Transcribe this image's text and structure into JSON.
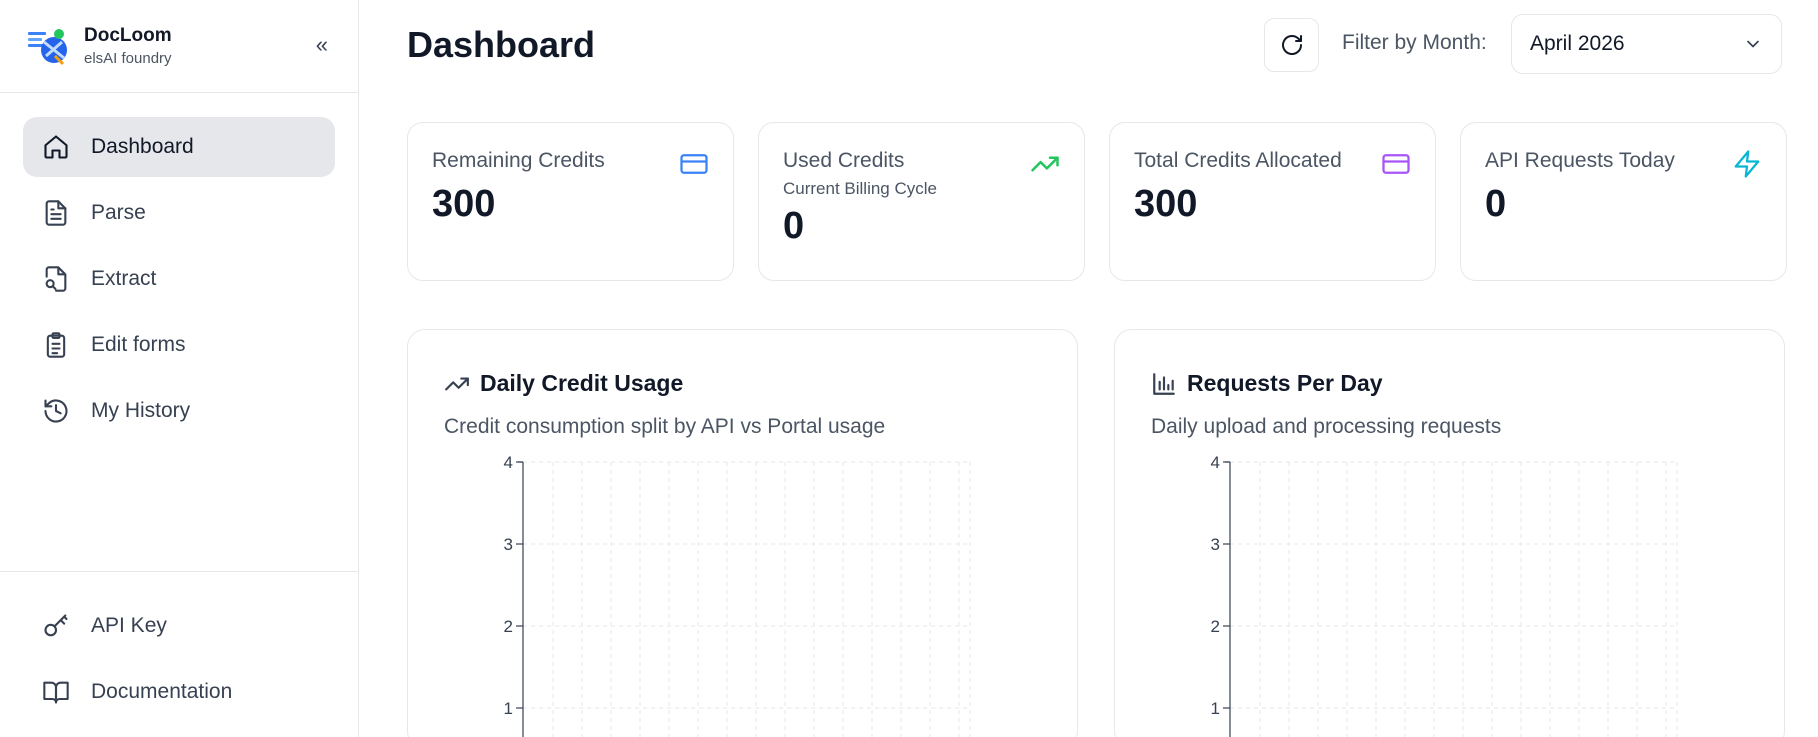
{
  "brand": {
    "name": "DocLoom",
    "subtitle": "elsAI foundry",
    "collapse_label": "«"
  },
  "sidebar": {
    "items": [
      {
        "label": "Dashboard",
        "icon": "home-icon",
        "active": true
      },
      {
        "label": "Parse",
        "icon": "file-text-icon"
      },
      {
        "label": "Extract",
        "icon": "file-search-icon"
      },
      {
        "label": "Edit forms",
        "icon": "clipboard-icon"
      },
      {
        "label": "My History",
        "icon": "history-icon"
      }
    ],
    "bottom_items": [
      {
        "label": "API Key",
        "icon": "key-icon"
      },
      {
        "label": "Documentation",
        "icon": "book-icon"
      }
    ]
  },
  "header": {
    "title": "Dashboard",
    "filter_label": "Filter by Month:",
    "month_value": "April 2026"
  },
  "cards": [
    {
      "title": "Remaining Credits",
      "subtitle": "",
      "value": "300",
      "icon": "credit-card-icon",
      "color": "#3b82f6"
    },
    {
      "title": "Used Credits",
      "subtitle": "Current Billing Cycle",
      "value": "0",
      "icon": "trending-up-icon",
      "color": "#22c55e"
    },
    {
      "title": "Total Credits Allocated",
      "subtitle": "",
      "value": "300",
      "icon": "credit-card-icon",
      "color": "#a855f7"
    },
    {
      "title": "API Requests Today",
      "subtitle": "",
      "value": "0",
      "icon": "zap-icon",
      "color": "#06b6d4"
    }
  ],
  "panels": {
    "daily_credit": {
      "title": "Daily Credit Usage",
      "description": "Credit consumption split by API vs Portal usage",
      "icon": "trending-up-icon"
    },
    "requests": {
      "title": "Requests Per Day",
      "description": "Daily upload and processing requests",
      "icon": "bar-chart-icon"
    }
  },
  "chart_data": [
    {
      "type": "line",
      "title": "Daily Credit Usage",
      "yticks": [
        4,
        3,
        2,
        1
      ],
      "ylim": [
        0,
        4
      ],
      "grid": true,
      "series": []
    },
    {
      "type": "bar",
      "title": "Requests Per Day",
      "yticks": [
        4,
        3,
        2,
        1
      ],
      "ylim": [
        0,
        4
      ],
      "grid": true,
      "series": []
    }
  ]
}
